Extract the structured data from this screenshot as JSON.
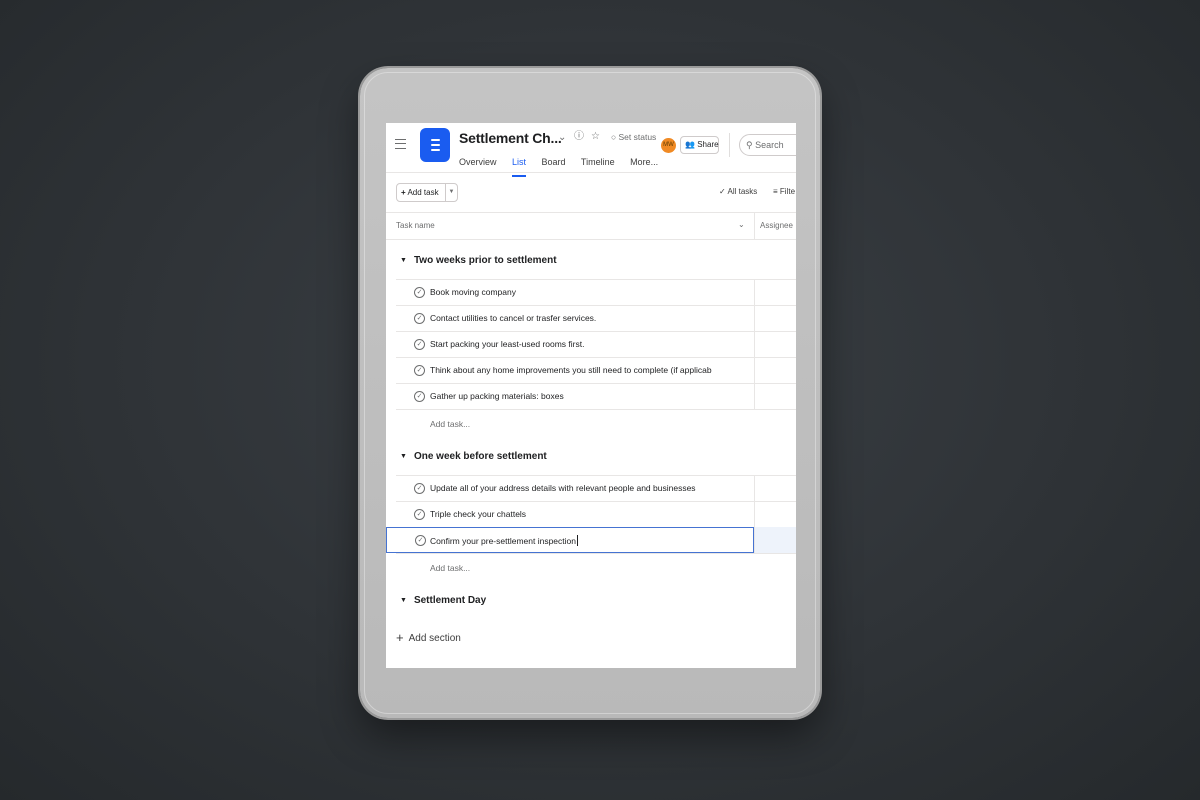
{
  "project": {
    "title": "Settlement Ch...",
    "set_status": "Set status",
    "avatar_initials": "MW",
    "share_label": "Share",
    "search_placeholder": "Search"
  },
  "tabs": [
    {
      "label": "Overview",
      "active": false
    },
    {
      "label": "List",
      "active": true
    },
    {
      "label": "Board",
      "active": false
    },
    {
      "label": "Timeline",
      "active": false
    },
    {
      "label": "More...",
      "active": false
    }
  ],
  "toolbar": {
    "add_task_label": "Add task",
    "all_tasks_label": "All tasks",
    "filter_label": "Filte"
  },
  "columns": {
    "task_name": "Task name",
    "assignee": "Assignee"
  },
  "sections": [
    {
      "title": "Two weeks prior to settlement",
      "tasks": [
        "Book moving company",
        "Contact utilities to cancel or trasfer services.",
        "Start packing your least-used rooms first.",
        "Think about any home improvements you still need to complete (if applicab",
        "Gather up packing materials: boxes"
      ],
      "add_task": "Add task..."
    },
    {
      "title": "One week before settlement",
      "tasks": [
        "Update all of your address details with relevant people and businesses",
        "Triple check your chattels",
        "Confirm your pre-settlement inspection"
      ],
      "add_task": "Add task..."
    },
    {
      "title": "Settlement Day",
      "tasks": []
    }
  ],
  "add_section_label": "Add section",
  "colors": {
    "accent": "#1a5cf0",
    "avatar": "#f08a24",
    "selected_border": "#4573d2"
  }
}
